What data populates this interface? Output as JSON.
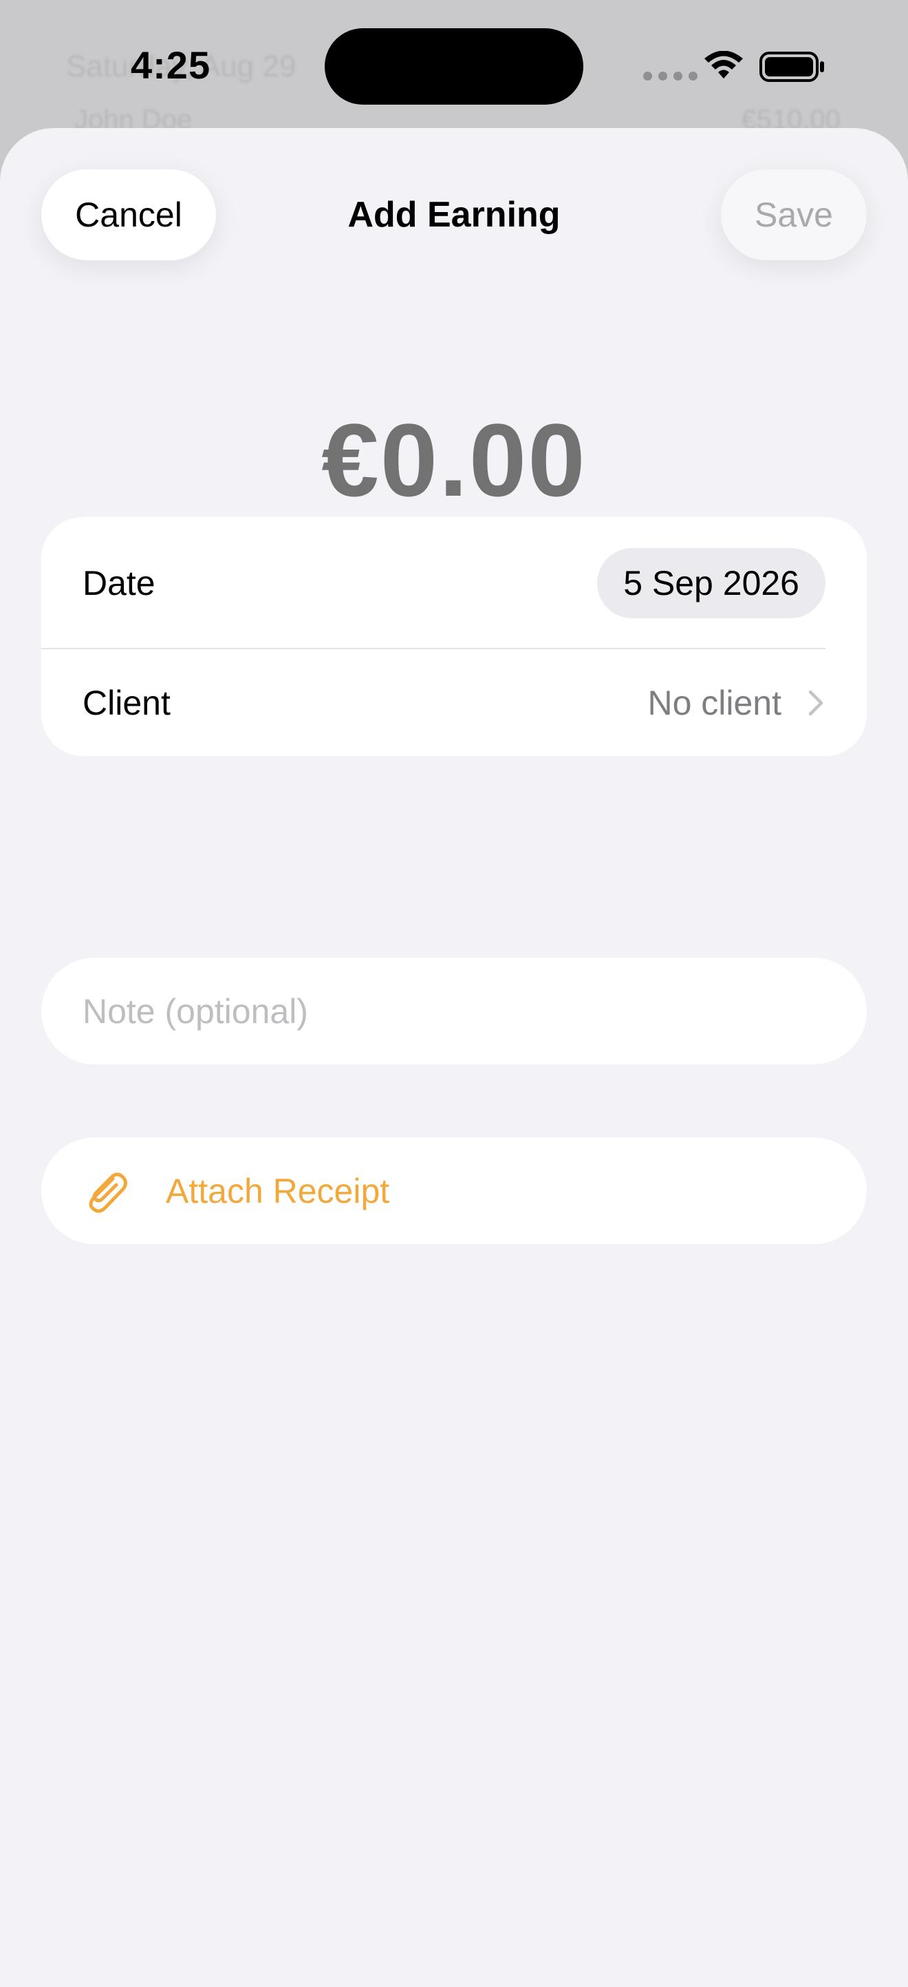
{
  "background": {
    "date_row": "Saturday, Aug 29",
    "client_row": "John Doe",
    "amount_row": "€510.00"
  },
  "status_bar": {
    "time": "4:25",
    "icons": [
      "cellular-signal-icon",
      "wifi-icon",
      "battery-icon"
    ]
  },
  "header": {
    "cancel_label": "Cancel",
    "title": "Add Earning",
    "save_label": "Save"
  },
  "amount": "€0.00",
  "fields": {
    "date_label": "Date",
    "date_value": "5 Sep 2026",
    "client_label": "Client",
    "client_value": "No client"
  },
  "note": {
    "placeholder": "Note (optional)",
    "value": ""
  },
  "attach": {
    "label": "Attach Receipt",
    "icon": "paperclip-icon"
  },
  "colors": {
    "accent": "#f2a83b",
    "sheet_background": "#f2f2f7",
    "card_background": "#ffffff",
    "secondary_text": "#7d7d82",
    "disabled_text": "#a8a8ad"
  }
}
